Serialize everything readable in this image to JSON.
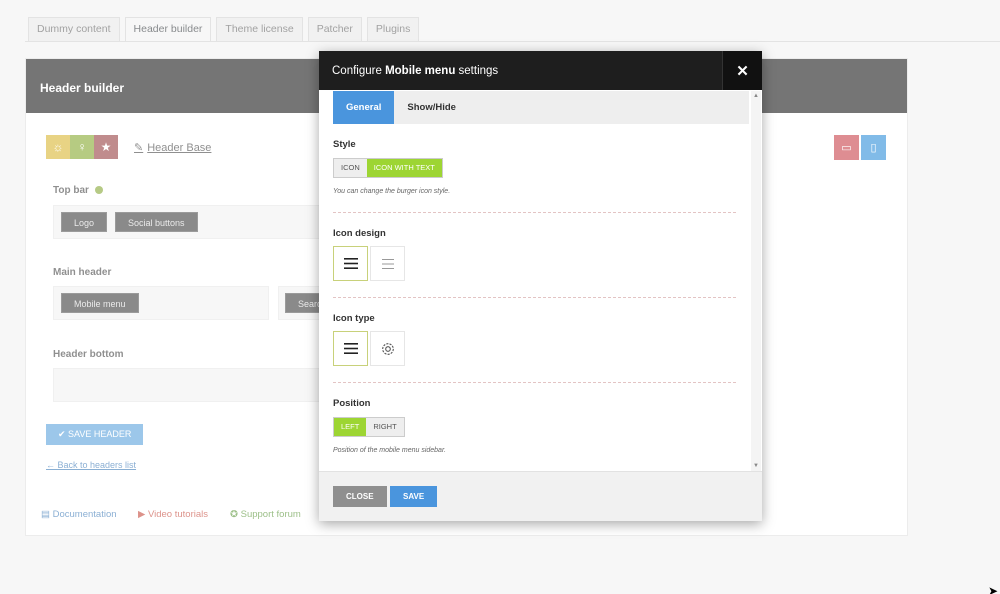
{
  "top_tabs": [
    {
      "label": "Dummy content"
    },
    {
      "label": "Header builder"
    },
    {
      "label": "Theme license"
    },
    {
      "label": "Patcher"
    },
    {
      "label": "Plugins"
    }
  ],
  "panel": {
    "title": "Header builder",
    "header_base": "Header Base",
    "sections": {
      "top_bar": "Top bar",
      "main_header": "Main header",
      "header_bottom": "Header bottom"
    },
    "elements": {
      "logo": "Logo",
      "social_buttons": "Social buttons",
      "mobile_menu": "Mobile menu",
      "search_partial": "Searc"
    },
    "save_header": "SAVE HEADER",
    "back_link": "← Back to headers list",
    "footer_links": {
      "documentation": "Documentation",
      "video_tutorials": "Video tutorials",
      "support_forum": "Support forum"
    }
  },
  "modal": {
    "title_prefix": "Configure ",
    "title_bold": "Mobile menu",
    "title_suffix": " settings",
    "tabs": [
      {
        "label": "General"
      },
      {
        "label": "Show/Hide"
      }
    ],
    "style": {
      "label": "Style",
      "options": [
        "ICON",
        "ICON WITH TEXT"
      ],
      "selected": "ICON WITH TEXT",
      "help": "You can change the burger icon style."
    },
    "icon_design": {
      "label": "Icon design"
    },
    "icon_type": {
      "label": "Icon type"
    },
    "position": {
      "label": "Position",
      "options": [
        "LEFT",
        "RIGHT"
      ],
      "selected": "LEFT",
      "help": "Position of the mobile menu sidebar."
    },
    "buttons": {
      "close": "CLOSE",
      "save": "SAVE"
    }
  },
  "colors": {
    "accent_blue": "#4a95dd",
    "accent_green": "#9dd533",
    "dark": "#1e1e1e"
  }
}
